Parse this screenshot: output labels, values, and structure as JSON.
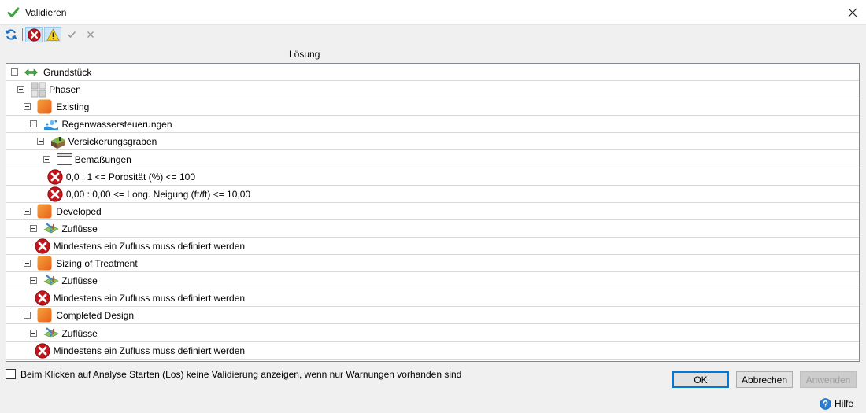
{
  "window": {
    "title": "Validieren",
    "icon": "green-check-icon"
  },
  "toolbar": {
    "buttons": [
      {
        "name": "refresh-icon",
        "active": false
      },
      {
        "name": "error-filter-icon",
        "active": true
      },
      {
        "name": "warning-filter-icon",
        "active": true
      },
      {
        "name": "check-icon",
        "active": false
      },
      {
        "name": "x-icon",
        "active": false
      }
    ]
  },
  "tree": {
    "column_header": "Lösung",
    "rows": [
      {
        "label": "Grundstück",
        "icon": "site-icon",
        "level": 0,
        "expanded": true
      },
      {
        "label": "Phasen",
        "icon": "phases-icon",
        "level": 1,
        "expanded": true
      },
      {
        "label": "Existing",
        "icon": "phase-icon",
        "level": 2,
        "expanded": true
      },
      {
        "label": "Regenwassersteuerungen",
        "icon": "stormwater-controls-icon",
        "level": 3,
        "expanded": true
      },
      {
        "label": "Versickerungsgraben",
        "icon": "infiltration-trench-icon",
        "level": 4,
        "expanded": true
      },
      {
        "label": "Bemaßungen",
        "icon": "dimensions-icon",
        "level": 5,
        "expanded": true
      },
      {
        "label": "0,0 : 1 <= Porosität (%) <= 100",
        "icon": "error-icon",
        "level": 6,
        "expanded": null
      },
      {
        "label": "0,00 : 0,00 <= Long. Neigung (ft/ft) <= 10,00",
        "icon": "error-icon",
        "level": 6,
        "expanded": null
      },
      {
        "label": "Developed",
        "icon": "phase-icon",
        "level": 2,
        "expanded": true
      },
      {
        "label": "Zuflüsse",
        "icon": "inflows-icon",
        "level": 3,
        "expanded": true
      },
      {
        "label": "Mindestens ein Zufluss muss definiert werden",
        "icon": "error-icon",
        "level": 4,
        "expanded": null
      },
      {
        "label": "Sizing of Treatment",
        "icon": "phase-icon",
        "level": 2,
        "expanded": true
      },
      {
        "label": "Zuflüsse",
        "icon": "inflows-icon",
        "level": 3,
        "expanded": true
      },
      {
        "label": "Mindestens ein Zufluss muss definiert werden",
        "icon": "error-icon",
        "level": 4,
        "expanded": null
      },
      {
        "label": "Completed Design",
        "icon": "phase-icon",
        "level": 2,
        "expanded": true
      },
      {
        "label": "Zuflüsse",
        "icon": "inflows-icon",
        "level": 3,
        "expanded": true
      },
      {
        "label": "Mindestens ein Zufluss muss definiert werden",
        "icon": "error-icon",
        "level": 4,
        "expanded": null
      }
    ]
  },
  "footer": {
    "checkbox_label": "Beim Klicken auf Analyse Starten (Los) keine Validierung anzeigen, wenn nur Warnungen vorhanden sind",
    "checkbox_checked": false,
    "ok_label": "OK",
    "cancel_label": "Abbrechen",
    "apply_label": "Anwenden",
    "help_label": "Hilfe"
  },
  "colors": {
    "accent": "#0078d7",
    "error": "#c4151c",
    "phase": "#f08a24",
    "grid_line": "#d8d8d8"
  }
}
